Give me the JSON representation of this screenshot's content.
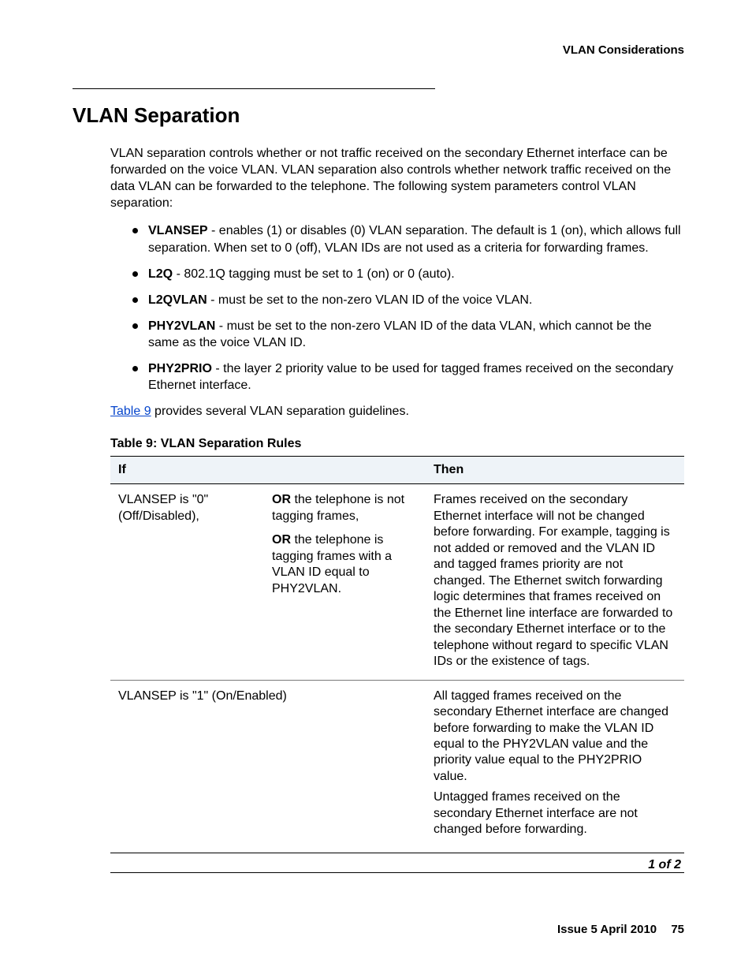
{
  "running_head": "VLAN Considerations",
  "title": "VLAN Separation",
  "intro": "VLAN separation controls whether or not traffic received on the secondary Ethernet interface can be forwarded on the voice VLAN. VLAN separation also controls whether network traffic received on the data VLAN can be forwarded to the telephone. The following system parameters control VLAN separation:",
  "params": [
    {
      "name": "VLANSEP",
      "desc": " - enables (1) or disables (0) VLAN separation. The default is 1 (on), which allows full separation. When set to 0 (off), VLAN IDs are not used as a criteria for forwarding frames."
    },
    {
      "name": "L2Q",
      "desc": " - 802.1Q tagging must be set to 1 (on) or 0 (auto)."
    },
    {
      "name": "L2QVLAN",
      "desc": " - must be set to the non-zero VLAN ID of the voice VLAN."
    },
    {
      "name": "PHY2VLAN",
      "desc": " - must be set to the non-zero VLAN ID of the data VLAN, which cannot be the same as the voice VLAN ID."
    },
    {
      "name": "PHY2PRIO",
      "desc": " - the layer 2 priority value to be used for tagged frames received on the secondary Ethernet interface."
    }
  ],
  "xref_label": "Table 9",
  "xref_tail": " provides several VLAN separation guidelines.",
  "table_caption": "Table 9: VLAN Separation Rules",
  "table": {
    "head_if": "If",
    "head_then": "Then",
    "rows": [
      {
        "if_a": "VLANSEP is \"0\" (Off/Disabled),",
        "if_b_or1_pre": "OR",
        "if_b_or1_post": " the telephone is not tagging frames,",
        "if_b_or2_pre": "OR",
        "if_b_or2_post": " the telephone is tagging frames with a VLAN ID equal to PHY2VLAN.",
        "then": "Frames received on the secondary Ethernet interface will not be changed before forwarding. For example, tagging is not added or removed and the VLAN ID and tagged frames priority are not changed. The Ethernet switch forwarding logic determines that frames received on the Ethernet line interface are forwarded to the secondary Ethernet interface or to the telephone without regard to specific VLAN IDs or the existence of tags."
      },
      {
        "if_a": "VLANSEP is \"1\" (On/Enabled)",
        "if_b_or1_pre": "",
        "if_b_or1_post": "",
        "if_b_or2_pre": "",
        "if_b_or2_post": "",
        "then_p1": "All tagged frames received on the secondary Ethernet interface are changed before forwarding to make the VLAN ID equal to the PHY2VLAN value and the priority value equal to the PHY2PRIO value.",
        "then_p2": "Untagged frames received on the secondary Ethernet interface are not changed before forwarding."
      }
    ],
    "pager": "1 of 2"
  },
  "footer_issue": "Issue 5   April 2010",
  "footer_page": "75"
}
